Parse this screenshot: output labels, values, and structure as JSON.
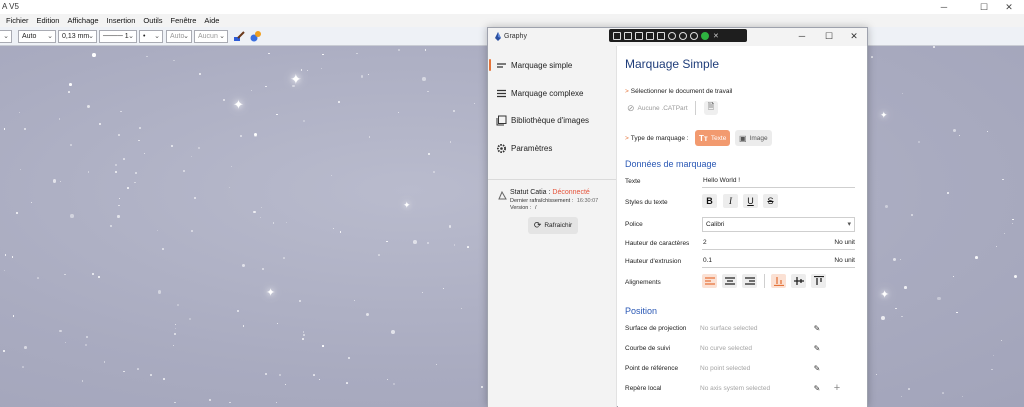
{
  "host": {
    "title": "A V5",
    "menu": [
      "Fichier",
      "Edition",
      "Affichage",
      "Insertion",
      "Outils",
      "Fenêtre",
      "Aide"
    ],
    "toolbar": {
      "f1": "Auto",
      "f2": "0,13 mm",
      "f3": "1",
      "f4": "•",
      "f5": "Auto",
      "f6": "Aucun"
    }
  },
  "graphy": {
    "title": "Graphy",
    "nav": [
      "Marquage simple",
      "Marquage complexe",
      "Bibliothèque d'images",
      "Paramètres"
    ],
    "status": {
      "label": "Statut Catia :",
      "value": "Déconnecté",
      "refresh_label": "Dernier rafraîchissement :",
      "refresh_time": "16:30:07",
      "version_label": "Version :",
      "version_value": "/",
      "button": "Rafraichir"
    },
    "main": {
      "title": "Marquage Simple",
      "select_doc": "Sélectionner le document de travail",
      "doc_value": "Aucune .CATPart",
      "type_label": "Type de marquage :",
      "type_text": "Texte",
      "type_image": "Image",
      "section_data": "Données de marquage",
      "texte_label": "Texte",
      "texte_value": "Hello World !",
      "styles_label": "Styles du texte",
      "police_label": "Police",
      "police_value": "Calibri",
      "hauteur_car_label": "Hauteur de caractères",
      "hauteur_car_value": "2",
      "hauteur_car_unit": "No unit",
      "hauteur_ext_label": "Hauteur d'extrusion",
      "hauteur_ext_value": "0.1",
      "hauteur_ext_unit": "No unit",
      "align_label": "Alignements",
      "section_pos": "Position",
      "surface_label": "Surface de projection",
      "surface_value": "No surface selected",
      "courbe_label": "Courbe de suivi",
      "courbe_value": "No curve selected",
      "point_label": "Point de référence",
      "point_value": "No point selected",
      "repere_label": "Repère local",
      "repere_value": "No axis system selected"
    }
  },
  "colors": {
    "accent": "#e5743a",
    "title": "#1f3d7a",
    "section": "#2a58b5",
    "status_bad": "#e5533a"
  }
}
